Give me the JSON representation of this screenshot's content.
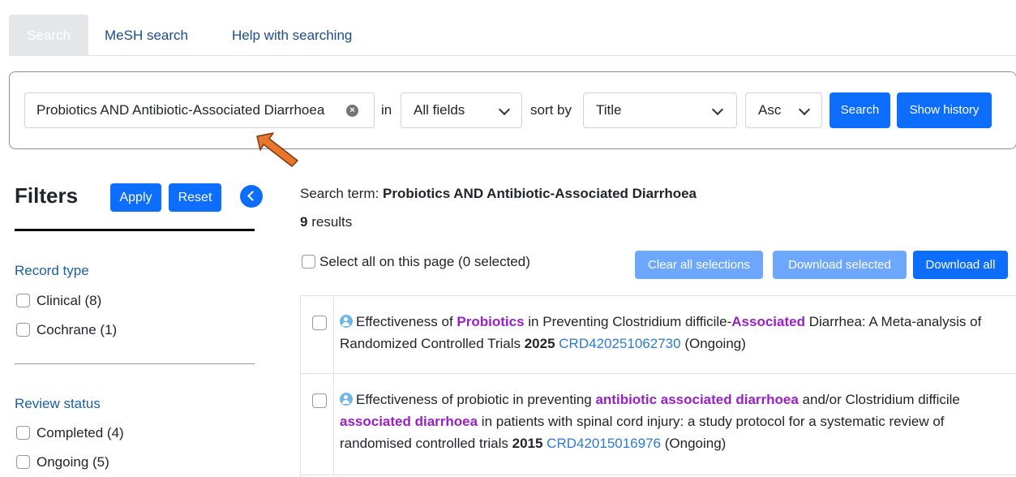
{
  "tabs": [
    {
      "label": "Search"
    },
    {
      "label": "MeSH search"
    },
    {
      "label": "Help with searching"
    }
  ],
  "search": {
    "query": "Probiotics AND Antibiotic-Associated Diarrhoea",
    "in_label": "in",
    "field_value": "All fields",
    "sort_label": "sort by",
    "sort_value": "Title",
    "order_value": "Asc",
    "search_button": "Search",
    "history_button": "Show history"
  },
  "filters": {
    "title": "Filters",
    "apply": "Apply",
    "reset": "Reset",
    "record_type": {
      "heading": "Record type",
      "items": [
        "Clinical (8)",
        "Cochrane (1)"
      ]
    },
    "review_status": {
      "heading": "Review status",
      "items": [
        "Completed (4)",
        "Ongoing (5)"
      ]
    }
  },
  "results": {
    "term_label": "Search term:",
    "term_value": "Probiotics AND Antibiotic-Associated Diarrhoea",
    "count": "9",
    "count_label": "results",
    "select_all": "Select all on this page (0 selected)",
    "clear_all": "Clear all selections",
    "download_selected": "Download selected",
    "download_all": "Download all",
    "rows": [
      {
        "p1": "Effectiveness of ",
        "h1": "Probiotics",
        "p2": " in Preventing Clostridium difficile-",
        "h2": "Associated",
        "p3": " Diarrhea: A Meta-analysis of Randomized Controlled Trials ",
        "year": "2025",
        "id": "CRD420251062730",
        "status": "(Ongoing)"
      },
      {
        "p1": "Effectiveness of probiotic in preventing ",
        "h1": "antibiotic associated diarrhoea",
        "p2": " and/or Clostridium difficile ",
        "h2": "associated diarrhoea",
        "p3": " in patients with spinal cord injury: a study protocol for a systematic review of randomised controlled trials ",
        "year": "2015",
        "id": "CRD42015016976",
        "status": "(Ongoing)"
      }
    ]
  },
  "colors": {
    "primary": "#0d6efd",
    "primary_disabled": "#6ea8fe",
    "highlight": "#9b1fc7",
    "link": "#2a7bd6",
    "annotation_arrow": "#e8762d"
  }
}
